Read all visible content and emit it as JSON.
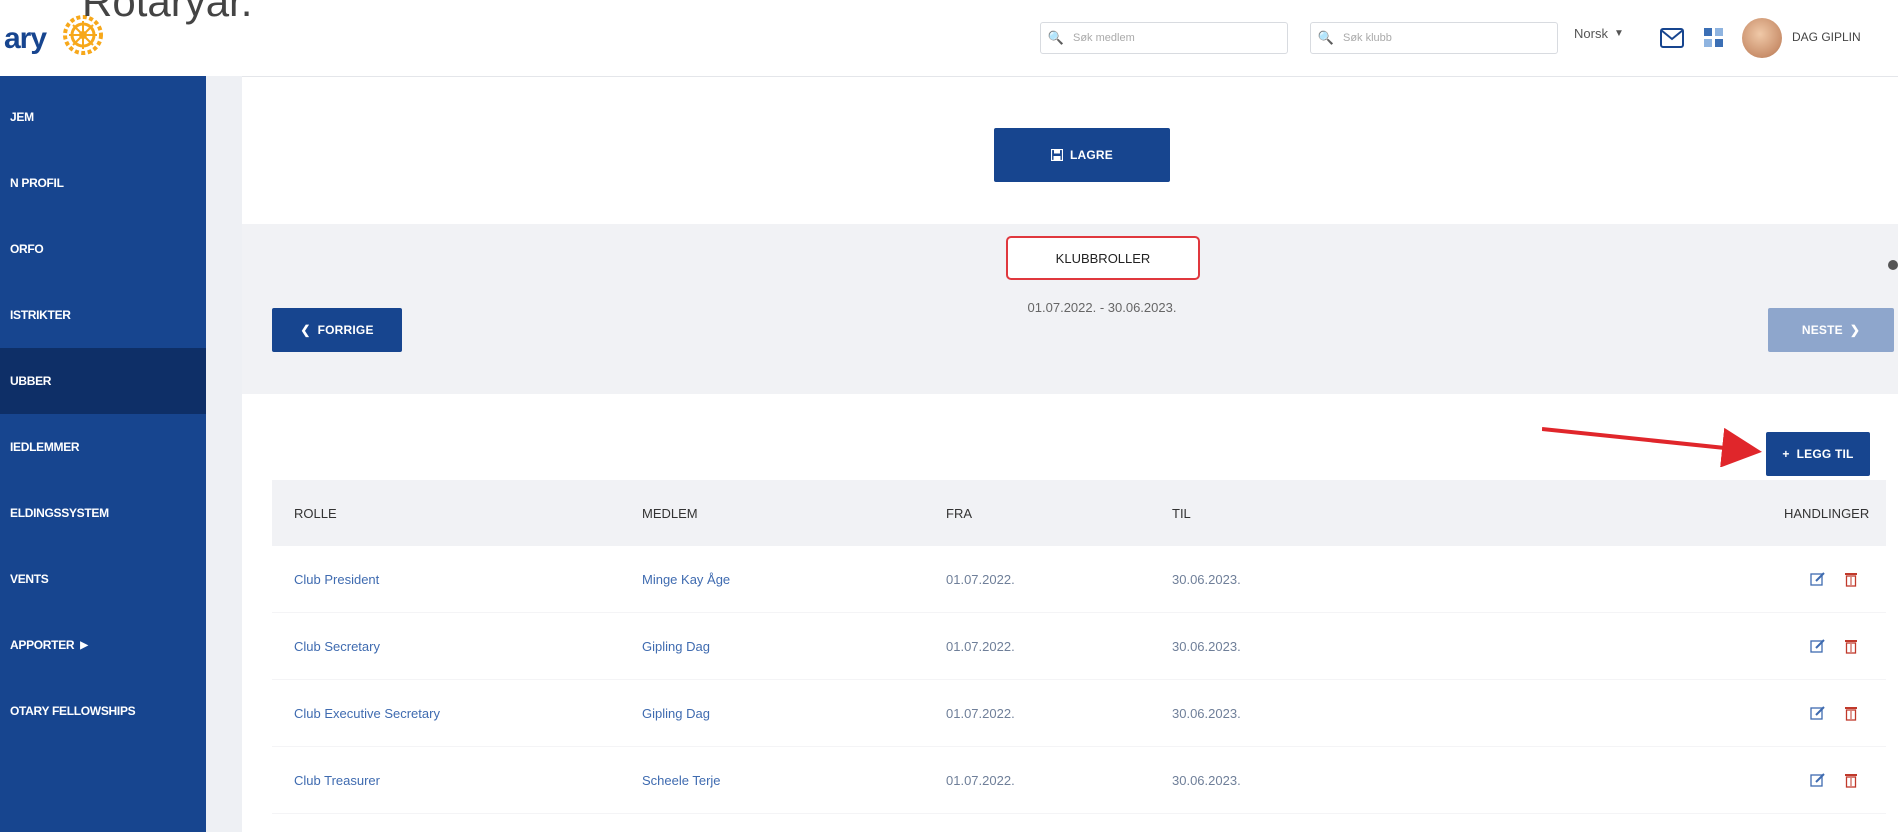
{
  "overlay_text": "Rotaryar.",
  "header": {
    "brand": "ary",
    "search_member_placeholder": "Søk medlem",
    "search_club_placeholder": "Søk klubb",
    "language": "Norsk",
    "username": "DAG GIPLIN"
  },
  "sidebar": {
    "items": [
      {
        "label": "JEM"
      },
      {
        "label": "N PROFIL"
      },
      {
        "label": "ORFO"
      },
      {
        "label": "ISTRIKTER"
      },
      {
        "label": "UBBER"
      },
      {
        "label": "IEDLEMMER"
      },
      {
        "label": "ELDINGSSYSTEM"
      },
      {
        "label": "VENTS"
      },
      {
        "label": "APPORTER"
      },
      {
        "label": "OTARY FELLOWSHIPS"
      }
    ]
  },
  "main": {
    "save_label": "LAGRE",
    "section_title": "KLUBBROLLER",
    "period": "01.07.2022. - 30.06.2023.",
    "prev_label": "FORRIGE",
    "next_label": "NESTE",
    "add_label": "LEGG TIL"
  },
  "table": {
    "headers": [
      "ROLLE",
      "MEDLEM",
      "FRA",
      "TIL",
      "HANDLINGER"
    ],
    "rows": [
      {
        "role": "Club President",
        "member": "Minge Kay Åge",
        "from": "01.07.2022.",
        "to": "30.06.2023."
      },
      {
        "role": "Club Secretary",
        "member": "Gipling Dag",
        "from": "01.07.2022.",
        "to": "30.06.2023."
      },
      {
        "role": "Club Executive Secretary",
        "member": "Gipling Dag",
        "from": "01.07.2022.",
        "to": "30.06.2023."
      },
      {
        "role": "Club Treasurer",
        "member": "Scheele Terje",
        "from": "01.07.2022.",
        "to": "30.06.2023."
      }
    ]
  },
  "colors": {
    "primary": "#17458f",
    "sidebar_active": "#0e2f67",
    "highlight_border": "#e0383e",
    "arrow": "#e0262b",
    "delete_icon": "#c0392b"
  }
}
